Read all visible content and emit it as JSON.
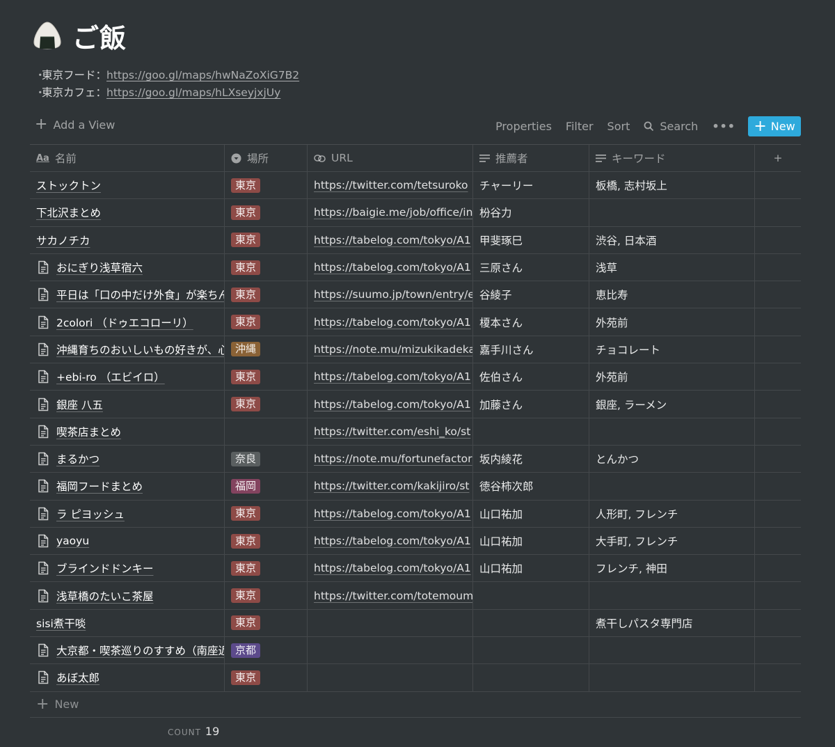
{
  "page": {
    "title": "ご飯",
    "icon": "onigiri-icon",
    "bullets": [
      {
        "dot": "・",
        "label": "東京フード：",
        "link": "https://goo.gl/maps/hwNaZoXiG7B2"
      },
      {
        "dot": "・",
        "label": "東京カフェ：",
        "link": "https://goo.gl/maps/hLXseyjxjUy"
      }
    ]
  },
  "toolbar": {
    "add_view": "Add a View",
    "properties": "Properties",
    "filter": "Filter",
    "sort": "Sort",
    "search": "Search",
    "more": "•••",
    "new": "New"
  },
  "columns": {
    "name": "名前",
    "location": "場所",
    "url": "URL",
    "recommender": "推薦者",
    "keywords": "キーワード"
  },
  "tag_colors": {
    "東京": "#8e4b47",
    "沖縄": "#8a6236",
    "奈良": "#5a5f60",
    "福岡": "#83435f",
    "京都": "#5c4a8b"
  },
  "rows": [
    {
      "name": "ストックトン",
      "doc": false,
      "location": "東京",
      "url": "https://twitter.com/tetsuroko",
      "recommender": "チャーリー",
      "keywords": "板橋, 志村坂上"
    },
    {
      "name": "下北沢まとめ",
      "doc": false,
      "location": "東京",
      "url": "https://baigie.me/job/office/in",
      "recommender": "枌谷力",
      "keywords": ""
    },
    {
      "name": "サカノチカ",
      "doc": false,
      "location": "東京",
      "url": "https://tabelog.com/tokyo/A1",
      "recommender": "甲斐琢巳",
      "keywords": "渋谷, 日本酒"
    },
    {
      "name": "おにぎり浅草宿六",
      "doc": true,
      "location": "東京",
      "url": "https://tabelog.com/tokyo/A1",
      "recommender": "三原さん",
      "keywords": "浅草"
    },
    {
      "name": "平日は「口の中だけ外食」が楽ちん",
      "doc": true,
      "location": "東京",
      "url": "https://suumo.jp/town/entry/e",
      "recommender": "谷綾子",
      "keywords": "恵比寿"
    },
    {
      "name": "2colori （ドゥエコローリ）",
      "doc": true,
      "location": "東京",
      "url": "https://tabelog.com/tokyo/A1",
      "recommender": "榎本さん",
      "keywords": "外苑前"
    },
    {
      "name": "沖縄育ちのおいしいもの好きが、心",
      "doc": true,
      "location": "沖縄",
      "url": "https://note.mu/mizukikadeka",
      "recommender": "嘉手川さん",
      "keywords": "チョコレート"
    },
    {
      "name": "+ebi-ro （エビイロ）",
      "doc": true,
      "location": "東京",
      "url": "https://tabelog.com/tokyo/A1",
      "recommender": "佐伯さん",
      "keywords": "外苑前"
    },
    {
      "name": "銀座 八五",
      "doc": true,
      "location": "東京",
      "url": "https://tabelog.com/tokyo/A1",
      "recommender": "加藤さん",
      "keywords": "銀座, ラーメン"
    },
    {
      "name": "喫茶店まとめ",
      "doc": true,
      "location": "",
      "url": "https://twitter.com/eshi_ko/st",
      "recommender": "",
      "keywords": ""
    },
    {
      "name": "まるかつ",
      "doc": true,
      "location": "奈良",
      "url": "https://note.mu/fortunefactor",
      "recommender": "坂内綾花",
      "keywords": "とんかつ"
    },
    {
      "name": "福岡フードまとめ",
      "doc": true,
      "location": "福岡",
      "url": "https://twitter.com/kakijiro/st",
      "recommender": "徳谷柿次郎",
      "keywords": ""
    },
    {
      "name": "ラ ピヨッシュ",
      "doc": true,
      "location": "東京",
      "url": "https://tabelog.com/tokyo/A1",
      "recommender": "山口祐加",
      "keywords": "人形町, フレンチ"
    },
    {
      "name": "yaoyu",
      "doc": true,
      "location": "東京",
      "url": "https://tabelog.com/tokyo/A1",
      "recommender": "山口祐加",
      "keywords": "大手町, フレンチ"
    },
    {
      "name": "ブラインドドンキー",
      "doc": true,
      "location": "東京",
      "url": "https://tabelog.com/tokyo/A1",
      "recommender": "山口祐加",
      "keywords": "フレンチ, 神田"
    },
    {
      "name": "浅草橋のたいこ茶屋",
      "doc": true,
      "location": "東京",
      "url": "https://twitter.com/totemoum",
      "recommender": "",
      "keywords": ""
    },
    {
      "name": "sisi煮干啖",
      "doc": false,
      "location": "東京",
      "url": "",
      "recommender": "",
      "keywords": "煮干しパスタ専門店"
    },
    {
      "name": "大京都・喫茶巡りのすすめ（南座近",
      "doc": true,
      "location": "京都",
      "url": "",
      "recommender": "",
      "keywords": ""
    },
    {
      "name": "あぼ太郎",
      "doc": true,
      "location": "東京",
      "url": "",
      "recommender": "",
      "keywords": ""
    }
  ],
  "footer": {
    "new_row": "New",
    "count_label": "COUNT",
    "count_value": "19"
  }
}
